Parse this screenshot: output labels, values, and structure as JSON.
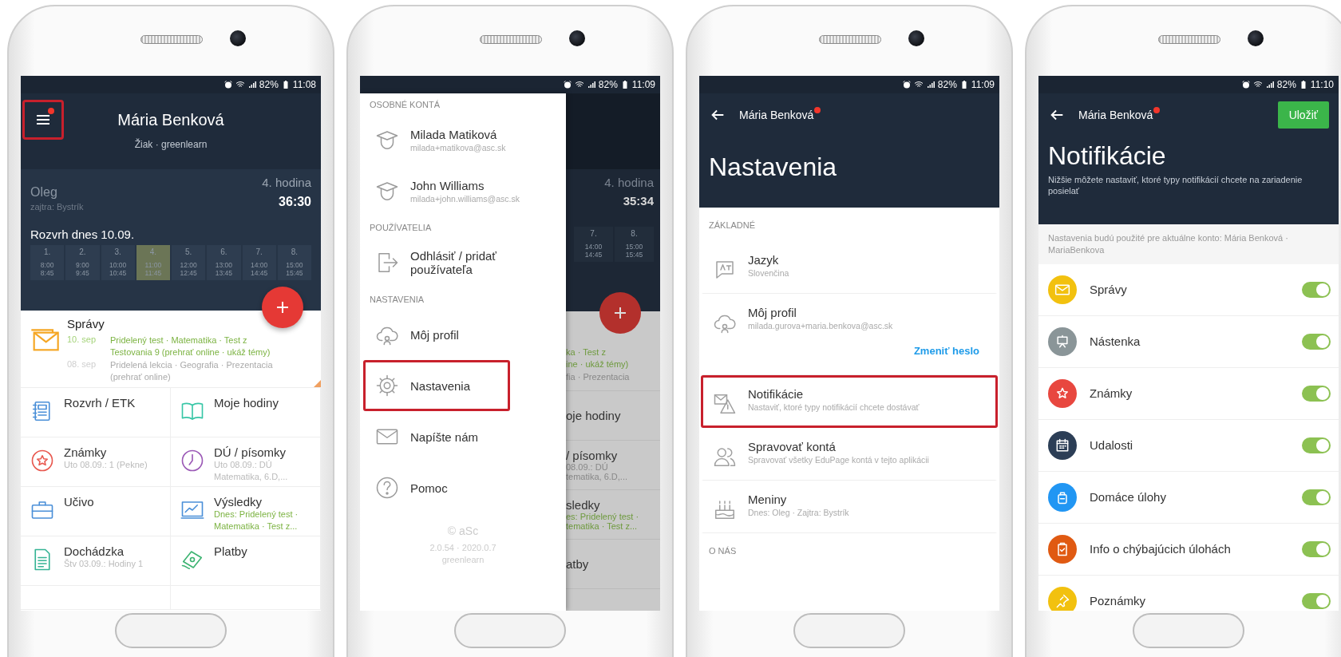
{
  "home_screen": {
    "status_bar": {
      "battery": "82%",
      "time": "11:08"
    },
    "menu_button": {
      "badge": true,
      "highlighted": true
    },
    "user_name": "Mária Benková",
    "user_role": "Žiak · greenlearn",
    "nameday": {
      "today": "Oleg",
      "tomorrow": "zajtra: Bystrík"
    },
    "current_lesson": {
      "label": "4. hodina",
      "countdown": "36:30"
    },
    "timetable": {
      "title": "Rozvrh dnes 10.09.",
      "periods": [
        {
          "number": "1.",
          "start": "8:00",
          "end": "8:45",
          "selected": false
        },
        {
          "number": "2.",
          "start": "9:00",
          "end": "9:45",
          "selected": false
        },
        {
          "number": "3.",
          "start": "10:00",
          "end": "10:45",
          "selected": false
        },
        {
          "number": "4.",
          "start": "11:00",
          "end": "11:45",
          "selected": true
        },
        {
          "number": "5.",
          "start": "12:00",
          "end": "12:45",
          "selected": false
        },
        {
          "number": "6.",
          "start": "13:00",
          "end": "13:45",
          "selected": false
        },
        {
          "number": "7.",
          "start": "14:00",
          "end": "14:45",
          "selected": false
        },
        {
          "number": "8.",
          "start": "15:00",
          "end": "15:45",
          "selected": false
        }
      ]
    },
    "messages": {
      "title": "Správy",
      "items": [
        {
          "date": "10. sep",
          "text": "Pridelený test · Matematika · Test z Testovania 9 (prehrať online · ukáž témy)",
          "unread": true
        },
        {
          "date": "08. sep",
          "text": "Pridelená lekcia · Geografia · Prezentacia (prehrať online)",
          "unread": false
        }
      ]
    },
    "tiles": [
      {
        "kind": "notebook",
        "title": "Rozvrh / ETK"
      },
      {
        "kind": "book",
        "title": "Moje hodiny"
      },
      {
        "kind": "grade",
        "title": "Známky",
        "sub": "Uto 08.09.: 1 (Pekne)",
        "highlight": false
      },
      {
        "kind": "clock",
        "title": "DÚ / písomky",
        "sub": "Uto 08.09.: DÚ Matematika, 6.D,...",
        "highlight": false
      },
      {
        "kind": "briefcase",
        "title": "Učivo"
      },
      {
        "kind": "chart",
        "title": "Výsledky",
        "sub": "Dnes: Pridelený test · Matematika · Test z...",
        "highlight": true
      },
      {
        "kind": "sheet",
        "title": "Dochádzka",
        "sub": "Štv 03.09.: Hodiny 1",
        "highlight": false
      },
      {
        "kind": "money",
        "title": "Platby"
      }
    ]
  },
  "menu_screen": {
    "status_bar": {
      "battery": "82%",
      "time": "11:09"
    },
    "sections": [
      {
        "heading": "OSOBNÉ KONTÁ",
        "items": [
          {
            "kind": "graduate",
            "title": "Milada Matiková",
            "sub": "milada+matikova@asc.sk",
            "highlighted": false
          },
          {
            "kind": "graduate",
            "title": "John Williams",
            "sub": "milada+john.williams@asc.sk",
            "highlighted": false
          }
        ]
      },
      {
        "heading": "POUŽÍVATELIA",
        "items": [
          {
            "kind": "logout",
            "title": "Odhlásiť / pridať používateľa",
            "highlighted": false
          }
        ]
      },
      {
        "heading": "NASTAVENIA",
        "items": [
          {
            "kind": "cloud",
            "title": "Môj profil",
            "highlighted": false
          },
          {
            "kind": "gear",
            "title": "Nastavenia",
            "highlighted": true
          },
          {
            "kind": "mail",
            "title": "Napíšte nám",
            "highlighted": false
          },
          {
            "kind": "help",
            "title": "Pomoc",
            "highlighted": false
          }
        ]
      }
    ],
    "footer": [
      "© aSc",
      "2.0.54 · 2020.0.7",
      "greenlearn"
    ],
    "backdrop": {
      "current_lesson": {
        "label": "4. hodina",
        "countdown": "35:34"
      },
      "periods": [
        {
          "number": "7.",
          "start": "14:00",
          "end": "14:45"
        },
        {
          "number": "8.",
          "start": "15:00",
          "end": "15:45"
        }
      ],
      "message_fragments": [
        {
          "text": "ka · Test z",
          "unread": true
        },
        {
          "text": "ine · ukáž témy)",
          "unread": true
        },
        {
          "text": "fia · Prezentacia",
          "unread": false
        }
      ],
      "tile_fragments": [
        {
          "title": "oje hodiny"
        },
        {
          "title": "/ písomky",
          "sub": [
            "08.09.: DÚ",
            "tematika, 6.D,..."
          ],
          "highlight": false
        },
        {
          "title": "sledky",
          "sub": [
            "es: Pridelený test ·",
            "tematika · Test z..."
          ],
          "highlight": true
        },
        {
          "title": "atby"
        }
      ]
    }
  },
  "settings_screen": {
    "status_bar": {
      "battery": "82%",
      "time": "11:09"
    },
    "account_name": "Mária Benková",
    "account_badge": true,
    "title": "Nastavenia",
    "sections": [
      {
        "heading": "ZÁKLADNÉ",
        "items": [
          {
            "kind": "language",
            "title": "Jazyk",
            "sub": "Slovenčina",
            "highlighted": false
          },
          {
            "kind": "cloud",
            "title": "Môj profil",
            "sub": "milada.gurova+maria.benkova@asc.sk",
            "link": "Zmeniť heslo",
            "highlighted": false
          },
          {
            "kind": "notification",
            "title": "Notifikácie",
            "sub": "Nastaviť, ktoré typy notifikácií chcete dostávať",
            "highlighted": true
          },
          {
            "kind": "users",
            "title": "Spravovať kontá",
            "sub": "Spravovať všetky EduPage kontá v tejto aplikácii",
            "highlighted": false
          },
          {
            "kind": "cake",
            "title": "Meniny",
            "sub": "Dnes: Oleg · Zajtra: Bystrík",
            "highlighted": false
          }
        ]
      },
      {
        "heading": "O NÁS"
      }
    ]
  },
  "notifications_screen": {
    "status_bar": {
      "battery": "82%",
      "time": "11:10"
    },
    "account_name": "Mária Benková",
    "account_badge": true,
    "save_button": "Uložiť",
    "title": "Notifikácie",
    "description": "Nižšie môžete nastaviť, ktoré typy notifikácií chcete na zariadenie posielať",
    "account_note": "Nastavenia budú použité pre aktuálne konto: Mária Benková · MariaBenkova",
    "toggles": [
      {
        "kind": "mail",
        "label": "Správy",
        "color": "#f2c10f",
        "on": true
      },
      {
        "kind": "board",
        "label": "Nástenka",
        "color": "#8a9598",
        "on": true
      },
      {
        "kind": "star",
        "label": "Známky",
        "color": "#e8473f",
        "on": true
      },
      {
        "kind": "calendar",
        "label": "Udalosti",
        "color": "#2c3e56",
        "on": true
      },
      {
        "kind": "backpack",
        "label": "Domáce úlohy",
        "color": "#2196f3",
        "on": true
      },
      {
        "kind": "clipboard",
        "label": "Info o chýbajúcich úlohách",
        "color": "#e05a12",
        "on": true
      },
      {
        "kind": "pin",
        "label": "Poznámky",
        "color": "#f2c10f",
        "on": true
      }
    ]
  }
}
